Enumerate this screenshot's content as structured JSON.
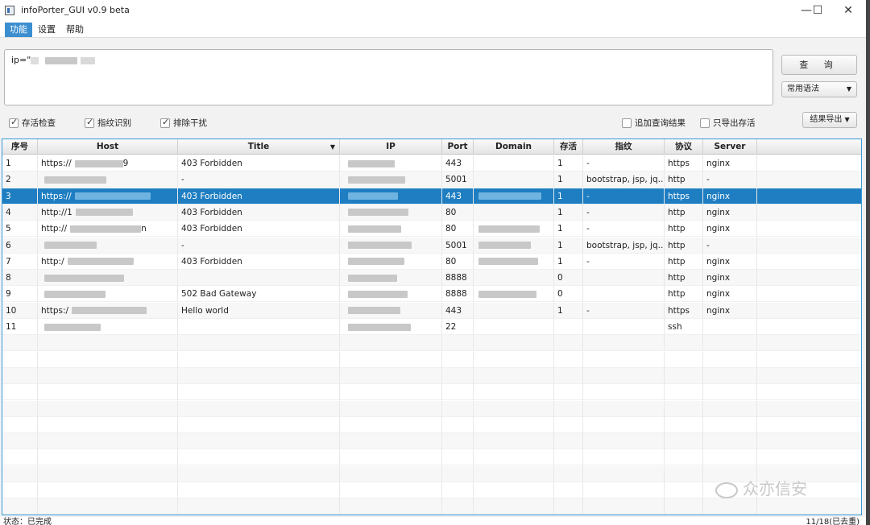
{
  "window": {
    "title": "infoPorter_GUI v0.9 beta",
    "minimize": "—",
    "maximize": "☐",
    "close": "✕"
  },
  "menu": [
    "功能",
    "设置",
    "帮助"
  ],
  "query": {
    "text": "ip=\"",
    "query_button": "查 询",
    "syntax_select": "常用语法"
  },
  "options": {
    "alive_check": {
      "label": "存活检查",
      "checked": true
    },
    "fingerprint": {
      "label": "指纹识别",
      "checked": true
    },
    "exclude_noise": {
      "label": "排除干扰",
      "checked": true
    },
    "append_results": {
      "label": "追加查询结果",
      "checked": false
    },
    "export_alive_only": {
      "label": "只导出存活",
      "checked": false
    },
    "export_button": "结果导出"
  },
  "table": {
    "columns": [
      "序号",
      "Host",
      "Title",
      "IP",
      "Port",
      "Domain",
      "存活",
      "指纹",
      "协议",
      "Server"
    ],
    "rows": [
      {
        "no": "1",
        "host": "https://",
        "host_tail": "9",
        "title": "403 Forbidden",
        "port": "443",
        "alive": "1",
        "fp": "-",
        "proto": "https",
        "server": "nginx"
      },
      {
        "no": "2",
        "host": "",
        "host_tail": "",
        "title": "-",
        "port": "5001",
        "alive": "1",
        "fp": "bootstrap, jsp, jq...",
        "proto": "http",
        "server": "-"
      },
      {
        "no": "3",
        "host": "https://",
        "host_tail": "",
        "title": "403 Forbidden",
        "port": "443",
        "alive": "1",
        "fp": "-",
        "proto": "https",
        "server": "nginx"
      },
      {
        "no": "4",
        "host": "http://1",
        "host_tail": "",
        "title": "403 Forbidden",
        "port": "80",
        "alive": "1",
        "fp": "-",
        "proto": "http",
        "server": "nginx"
      },
      {
        "no": "5",
        "host": "http://",
        "host_tail": "n",
        "title": "403 Forbidden",
        "port": "80",
        "alive": "1",
        "fp": "-",
        "proto": "http",
        "server": "nginx"
      },
      {
        "no": "6",
        "host": "",
        "host_tail": "",
        "title": "-",
        "port": "5001",
        "alive": "1",
        "fp": "bootstrap, jsp, jq...",
        "proto": "http",
        "server": "-"
      },
      {
        "no": "7",
        "host": "http:/",
        "host_tail": "",
        "title": "403 Forbidden",
        "port": "80",
        "alive": "1",
        "fp": "-",
        "proto": "http",
        "server": "nginx"
      },
      {
        "no": "8",
        "host": "",
        "host_tail": "",
        "title": "",
        "port": "8888",
        "alive": "0",
        "fp": "",
        "proto": "http",
        "server": "nginx"
      },
      {
        "no": "9",
        "host": "",
        "host_tail": "",
        "title": "502 Bad Gateway",
        "port": "8888",
        "alive": "0",
        "fp": "",
        "proto": "http",
        "server": "nginx"
      },
      {
        "no": "10",
        "host": "https:/",
        "host_tail": "",
        "title": "Hello world",
        "port": "443",
        "alive": "1",
        "fp": "-",
        "proto": "https",
        "server": "nginx"
      },
      {
        "no": "11",
        "host": "",
        "host_tail": "",
        "title": "",
        "port": "22",
        "alive": "",
        "fp": "",
        "proto": "ssh",
        "server": ""
      }
    ],
    "selected_row": 3
  },
  "status": {
    "left": "状态：已完成",
    "right": "11/18(已去重)"
  },
  "watermark": "众亦信安"
}
